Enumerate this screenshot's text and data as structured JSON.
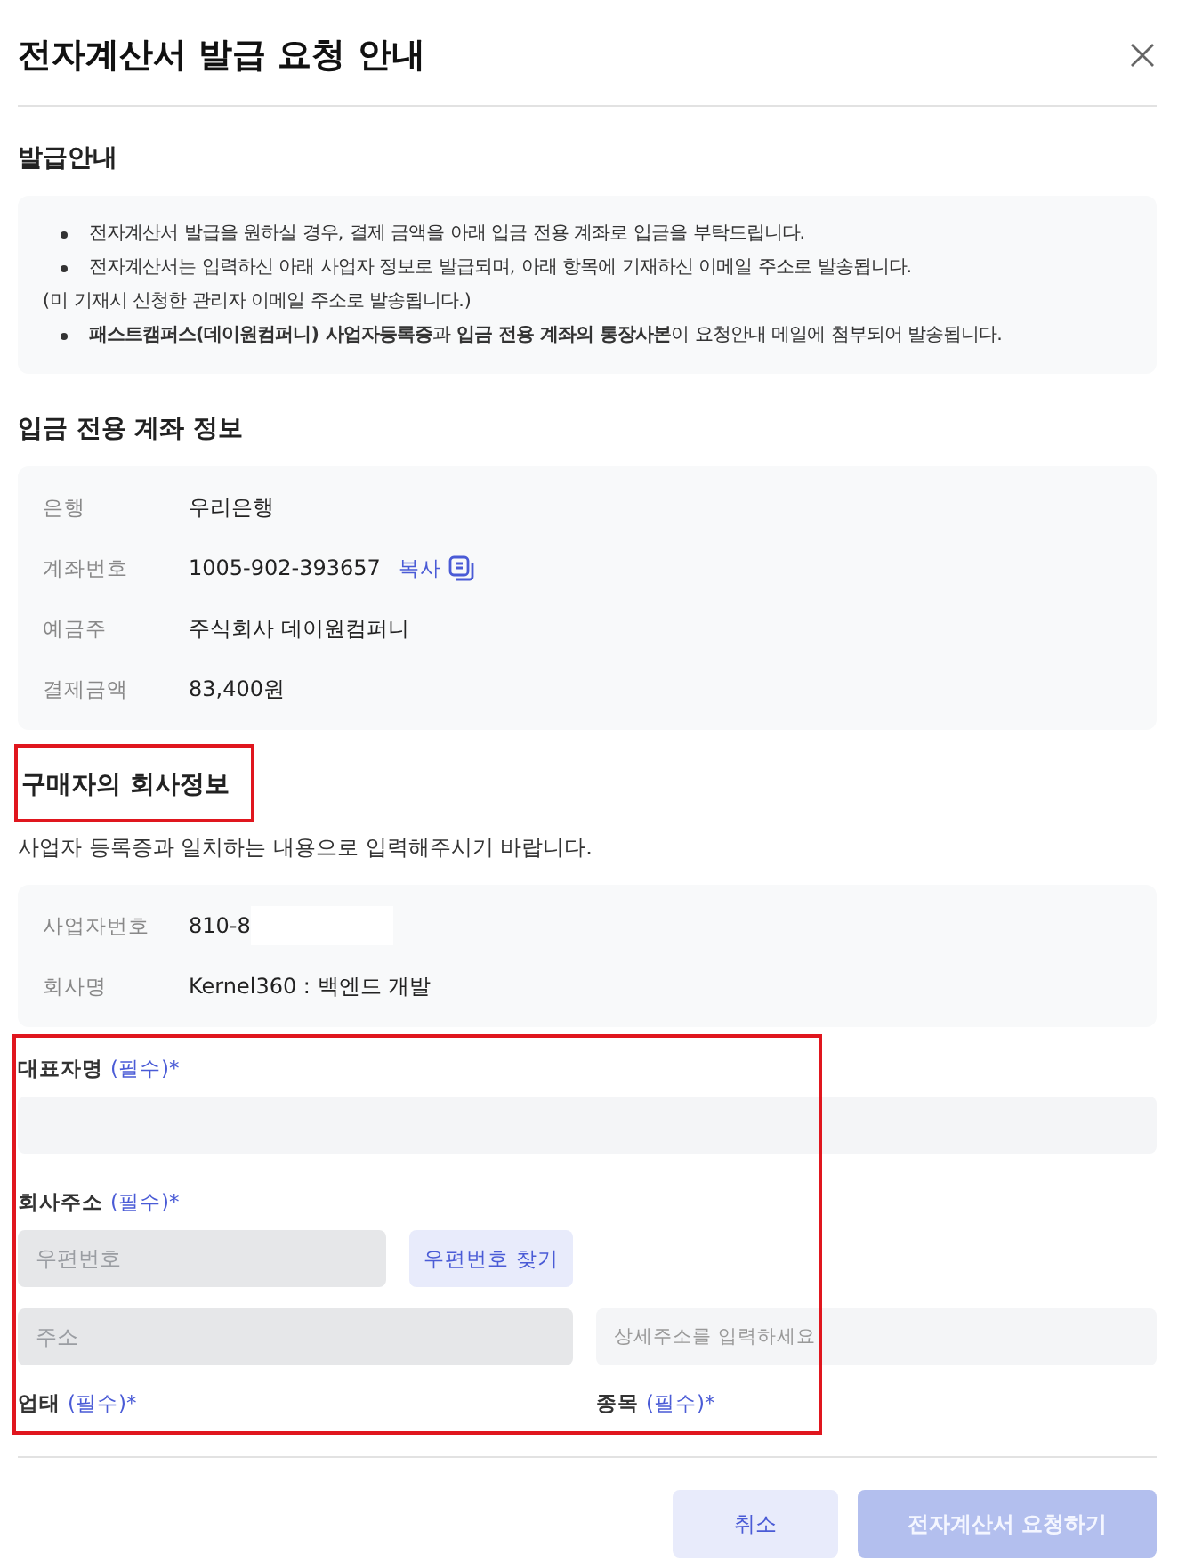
{
  "dialog": {
    "title": "전자계산서 발급 요청 안내"
  },
  "notice": {
    "heading": "발급안내",
    "lines": [
      {
        "kind": "bullet",
        "text": "전자계산서 발급을 원하실 경우, 결제 금액을 아래 입금 전용 계좌로 입금을 부탁드립니다."
      },
      {
        "kind": "bullet",
        "text": "전자계산서는 입력하신 아래 사업자 정보로 발급되며, 아래 항목에 기재하신 이메일 주소로 발송됩니다."
      },
      {
        "kind": "plain",
        "text": "(미 기재시 신청한 관리자 이메일 주소로 발송됩니다.)"
      },
      {
        "kind": "bullet",
        "text": "**패스트캠퍼스(데이원컴퍼니) 사업자등록증**과 **입금 전용 계좌의 통장사본**이 요청안내 메일에 첨부되어 발송됩니다."
      }
    ]
  },
  "account": {
    "heading": "입금 전용 계좌 정보",
    "rows": [
      {
        "label": "은행",
        "value": "우리은행"
      },
      {
        "label": "계좌번호",
        "value": "1005-902-393657",
        "action": "복사"
      },
      {
        "label": "예금주",
        "value": "주식회사 데이원컴퍼니"
      },
      {
        "label": "결제금액",
        "value": "83,400원"
      }
    ]
  },
  "buyer": {
    "heading": "구매자의 회사정보",
    "highlighted": true,
    "description": "사업자 등록증과 일치하는 내용으로 입력해주시기 바랍니다.",
    "rows": [
      {
        "label": "사업자번호",
        "value": "810-8",
        "redacted": true
      },
      {
        "label": "회사명",
        "value": "Kernel360 : 백엔드 개발"
      }
    ]
  },
  "form": {
    "highlighted": true,
    "representative": {
      "label": "대표자명",
      "required": "(필수)*"
    },
    "address": {
      "label": "회사주소",
      "required": "(필수)*",
      "zip": {
        "placeholder": "우편번호",
        "disabled": true
      },
      "search_button": "우편번호 찾기",
      "main": {
        "placeholder": "주소",
        "disabled": true
      },
      "detail": {
        "placeholder": "상세주소를 입력하세요",
        "disabled": false
      }
    },
    "business_type": {
      "label": "업태",
      "required": "(필수)*"
    },
    "business_item": {
      "label": "종목",
      "required": "(필수)*"
    }
  },
  "footer": {
    "buttons": [
      {
        "label": "취소",
        "kind": "secondary",
        "disabled": false
      },
      {
        "label": "전자계산서 요청하기",
        "kind": "primary",
        "disabled": true
      }
    ]
  }
}
